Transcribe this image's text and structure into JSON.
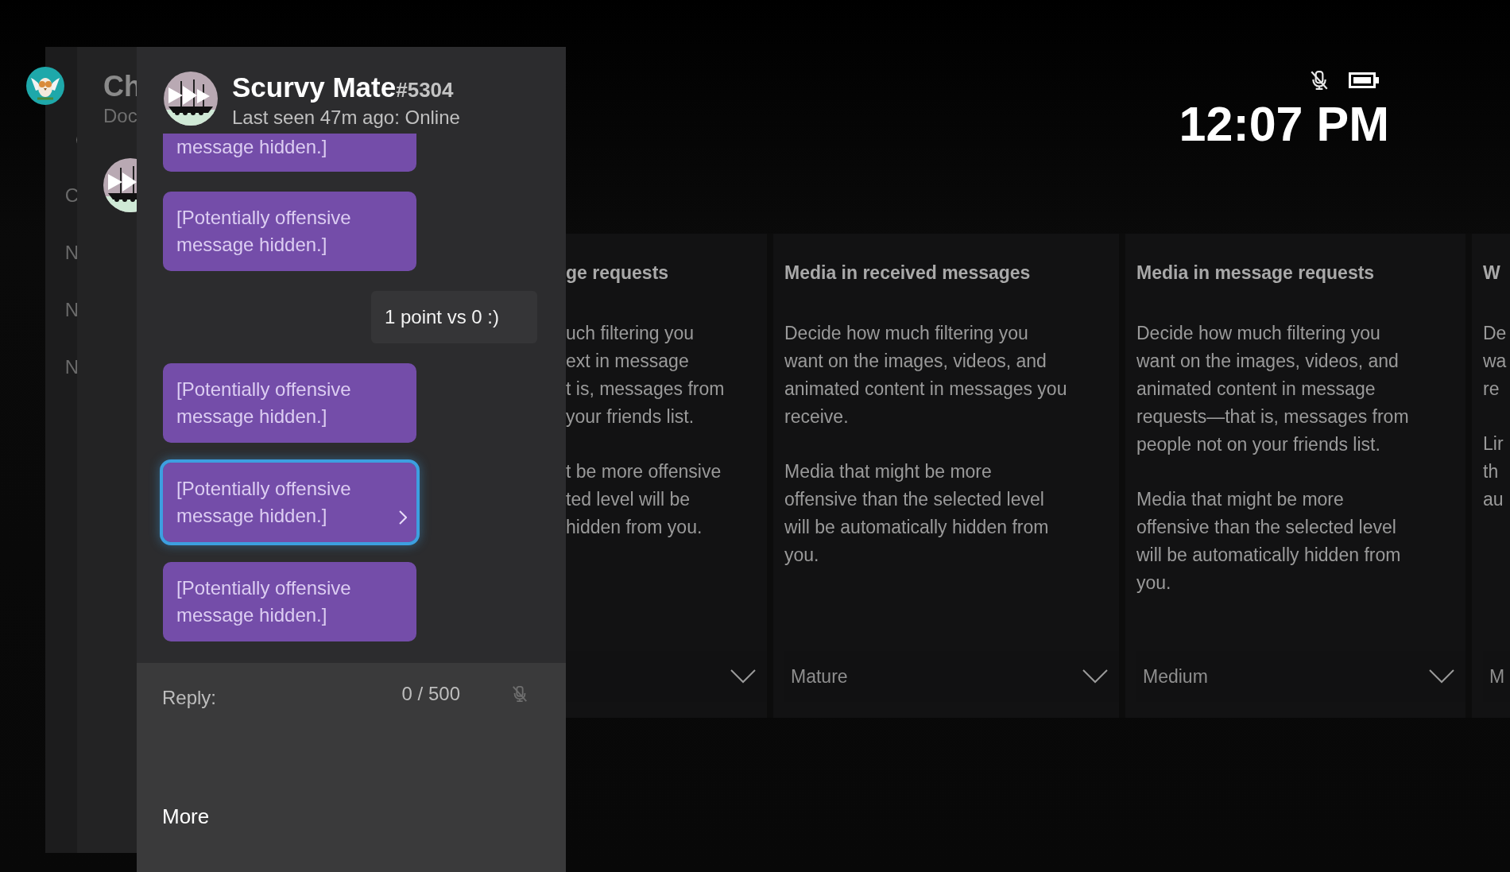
{
  "sidebar": {
    "title": "Ch",
    "subtitle": "Doc",
    "nav_letters": [
      "C",
      "N",
      "N",
      "N"
    ]
  },
  "status": {
    "time": "12:07 PM"
  },
  "settings": {
    "columns": [
      {
        "heading": "ge requests",
        "paragraphs": [
          [
            "uch filtering you",
            "ext in message",
            "t is, messages from",
            "your friends list."
          ],
          [
            "t be more offensive",
            "ted level will be",
            "hidden from you."
          ]
        ]
      },
      {
        "heading": "Media in received messages",
        "paragraphs": [
          [
            "Decide how much filtering you",
            "want on the images, videos, and",
            "animated content in messages you",
            "receive."
          ],
          [
            "Media that might be more",
            "offensive than the selected level",
            "will be automatically hidden from",
            "you."
          ]
        ],
        "dropdown": {
          "value": "Mature"
        }
      },
      {
        "heading": "Media in message requests",
        "paragraphs": [
          [
            "Decide how much filtering you",
            "want on the images, videos, and",
            "animated content in message",
            "requests—that is, messages from",
            "people not on your friends list."
          ],
          [
            "Media that might be more",
            "offensive than the selected level",
            "will be automatically hidden from",
            "you."
          ]
        ],
        "dropdown": {
          "value": "Medium"
        }
      },
      {
        "heading": "W",
        "paragraphs": [
          [
            "De",
            "wa",
            "re"
          ],
          [
            "Lir",
            "th",
            "au"
          ]
        ],
        "dropdown": {
          "value": "M"
        }
      }
    ]
  },
  "chat": {
    "contact": {
      "name": "Scurvy Mate",
      "tag": "#5304",
      "status": "Last seen 47m ago: Online"
    },
    "messages": [
      {
        "kind": "received",
        "text": "message hidden.]",
        "selected": false
      },
      {
        "kind": "received",
        "text": "[Potentially offensive message hidden.]",
        "selected": false
      },
      {
        "kind": "sent",
        "text": "1 point vs 0 :)",
        "selected": false
      },
      {
        "kind": "received",
        "text": "[Potentially offensive message hidden.]",
        "selected": false
      },
      {
        "kind": "received",
        "text": "[Potentially offensive message hidden.]",
        "selected": true
      },
      {
        "kind": "received",
        "text": "[Potentially offensive message hidden.]",
        "selected": false
      }
    ],
    "reply": {
      "label": "Reply:",
      "counter": "0 / 500"
    },
    "more": "More"
  }
}
